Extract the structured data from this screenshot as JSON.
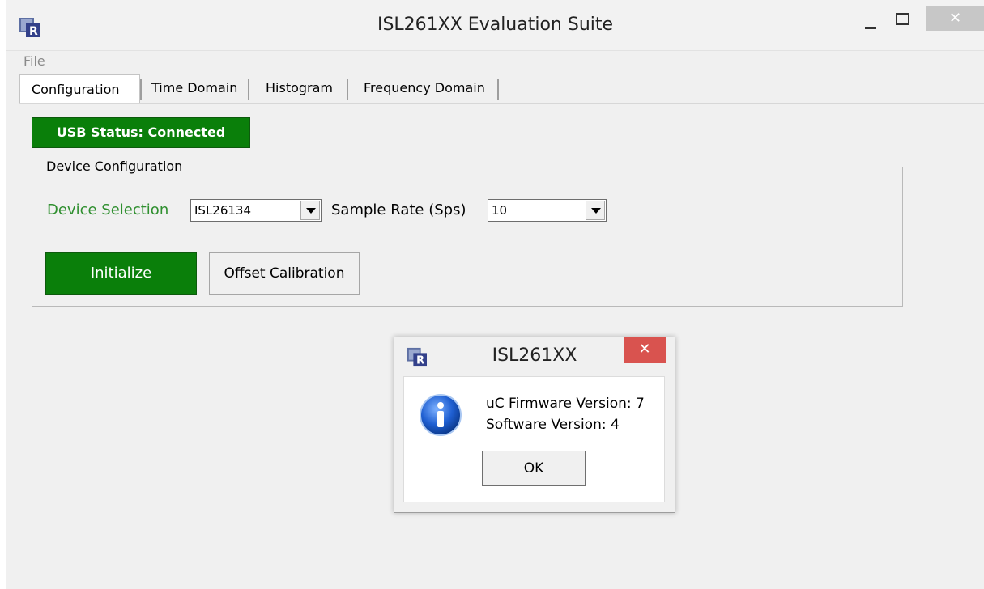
{
  "window": {
    "title": "ISL261XX Evaluation Suite",
    "close_glyph": "✕"
  },
  "menu": {
    "file_label": "File"
  },
  "tabs": [
    {
      "label": "Configuration",
      "active": true
    },
    {
      "label": "Time Domain"
    },
    {
      "label": "Histogram"
    },
    {
      "label": "Frequency Domain"
    }
  ],
  "usb_status": {
    "label": "USB Status: Connected",
    "color": "#0a7f0a"
  },
  "device_config": {
    "group_label": "Device Configuration",
    "device_label": "Device Selection",
    "device_value": "ISL26134",
    "rate_label": "Sample Rate (Sps)",
    "rate_value": "10",
    "initialize_label": "Initialize",
    "offset_label": "Offset Calibration"
  },
  "dialog": {
    "title": "ISL261XX",
    "close_glyph": "✕",
    "line1": "uC Firmware Version: 7",
    "line2": "Software Version: 4",
    "ok_label": "OK",
    "icon": "info-icon"
  }
}
